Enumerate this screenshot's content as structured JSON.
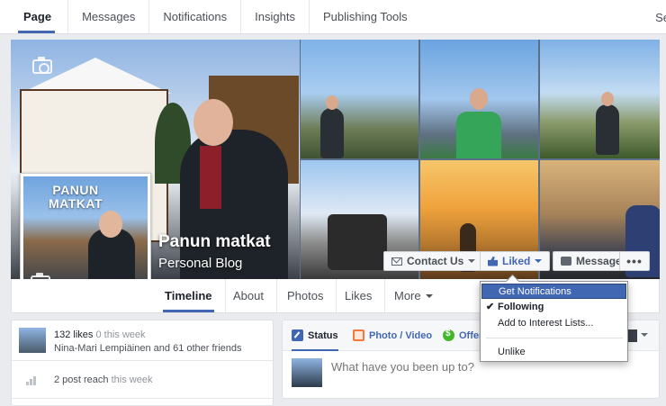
{
  "topnav": {
    "tabs": [
      {
        "label": "Page",
        "active": true
      },
      {
        "label": "Messages"
      },
      {
        "label": "Notifications"
      },
      {
        "label": "Insights"
      },
      {
        "label": "Publishing Tools"
      }
    ],
    "cut_tab": "Se"
  },
  "cover": {
    "page_name": "Panun matkat",
    "category": "Personal Blog"
  },
  "profile": {
    "logo_text": "PANUN\nMATKAT"
  },
  "actions": {
    "contact": "Contact Us",
    "liked": "Liked",
    "message": "Message",
    "more": "•••"
  },
  "pagenav": {
    "tabs": [
      {
        "label": "Timeline",
        "active": true
      },
      {
        "label": "About"
      },
      {
        "label": "Photos"
      },
      {
        "label": "Likes"
      },
      {
        "label": "More"
      }
    ]
  },
  "liked_menu": {
    "items": [
      {
        "label": "Get Notifications",
        "highlighted": true
      },
      {
        "label": "Following",
        "checked": true
      },
      {
        "label": "Add to Interest Lists..."
      },
      {
        "label": "Unlike"
      }
    ]
  },
  "stats": {
    "likes_count": "132 likes",
    "likes_week": "0 this week",
    "friends": "Nina-Mari Lempiäinen and 61 other friends",
    "reach_count": "2 post reach",
    "reach_week": "this week"
  },
  "composer": {
    "tabs": [
      {
        "label": "Status",
        "active": true
      },
      {
        "label": "Photo / Video"
      },
      {
        "label": "Offer"
      }
    ],
    "placeholder": "What have you been up to?"
  },
  "colors": {
    "brand_blue": "#4267b2",
    "background": "#e9ebee"
  }
}
